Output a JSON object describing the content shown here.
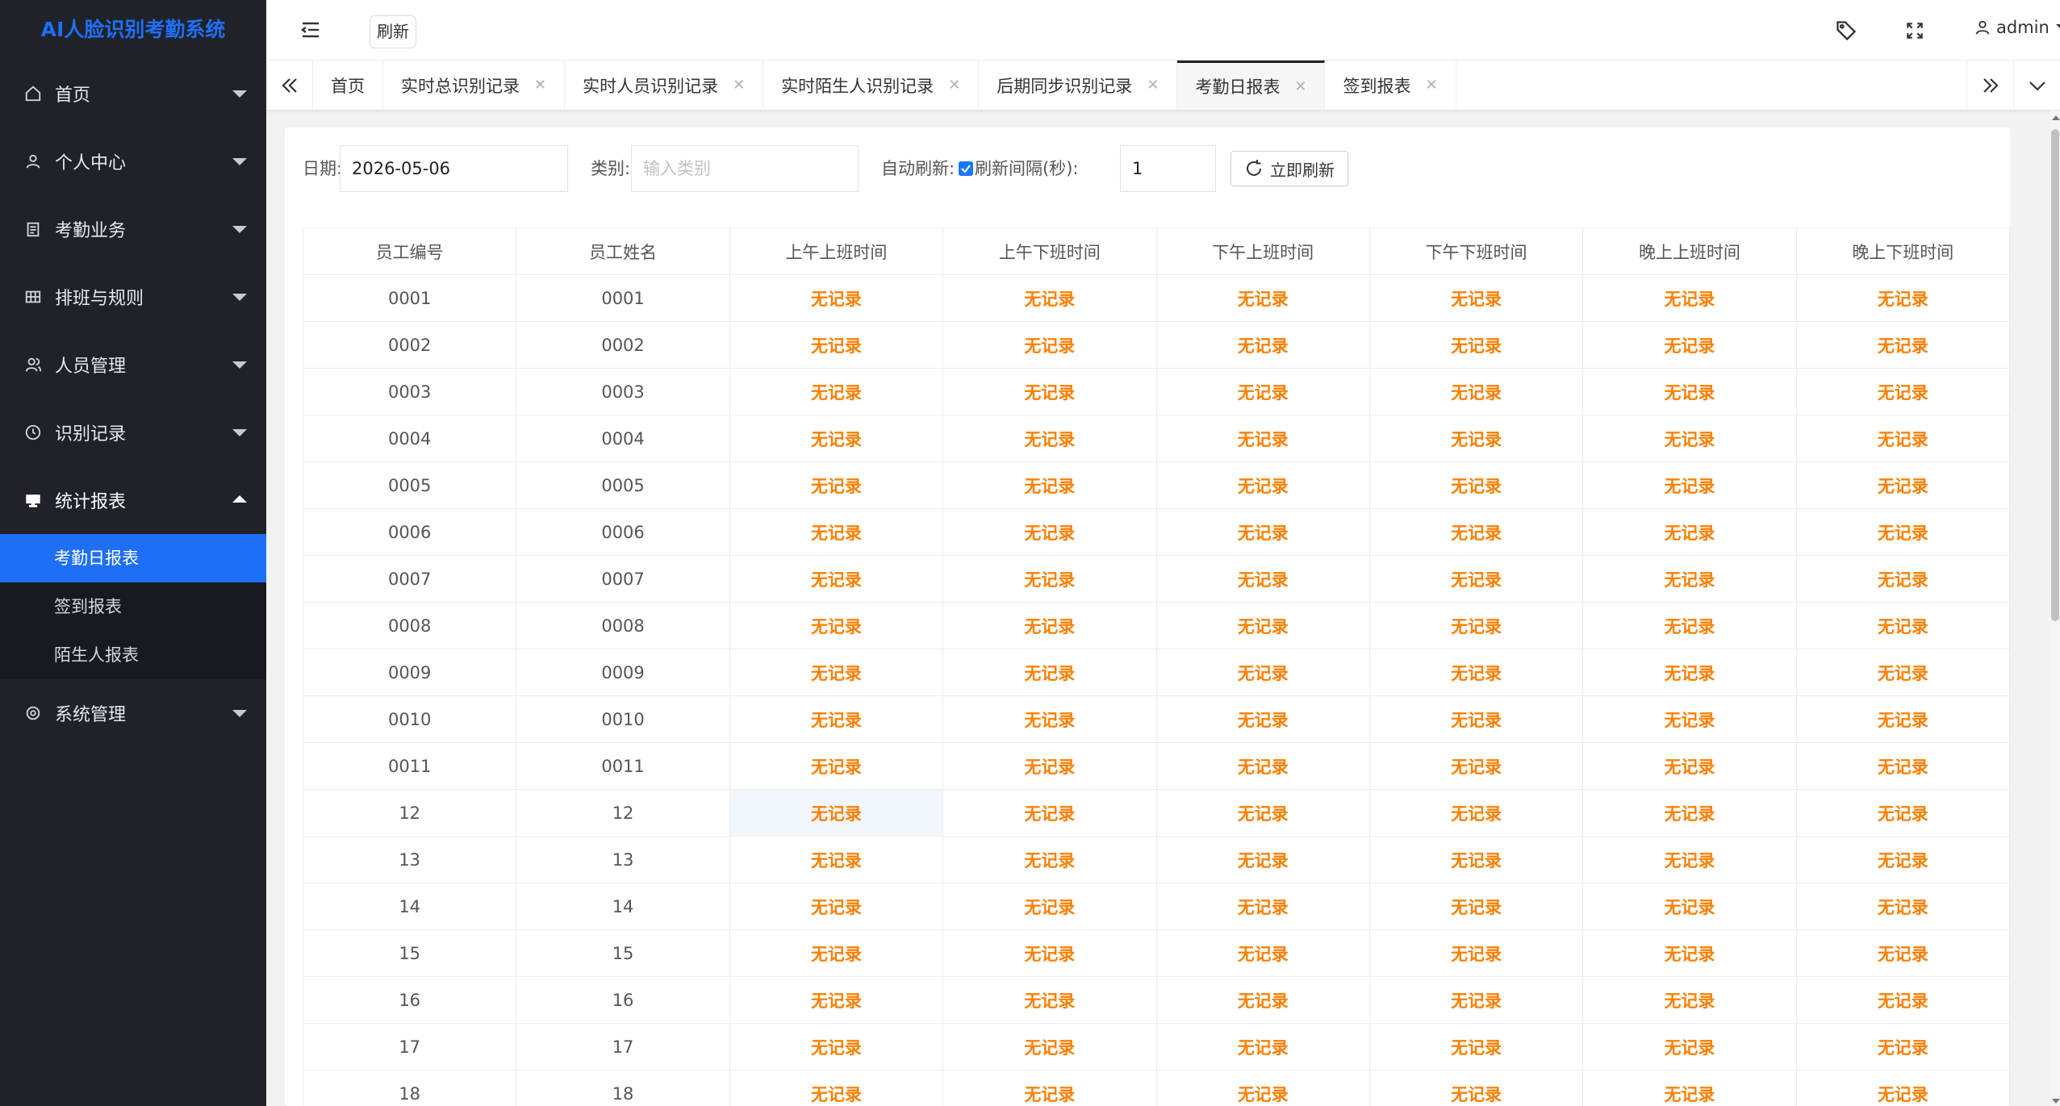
{
  "app": {
    "title": "AI人脸识别考勤系统"
  },
  "header": {
    "refresh_label": "刷新",
    "user_name": "admin"
  },
  "sidebar": {
    "items": [
      {
        "label": "首页",
        "icon": "home-icon"
      },
      {
        "label": "个人中心",
        "icon": "user-icon"
      },
      {
        "label": "考勤业务",
        "icon": "clipboard-icon"
      },
      {
        "label": "排班与规则",
        "icon": "grid-icon"
      },
      {
        "label": "人员管理",
        "icon": "people-icon"
      },
      {
        "label": "识别记录",
        "icon": "clock-icon"
      },
      {
        "label": "统计报表",
        "icon": "monitor-icon"
      },
      {
        "label": "系统管理",
        "icon": "settings-icon"
      }
    ],
    "submenu": [
      {
        "label": "考勤日报表"
      },
      {
        "label": "签到报表"
      },
      {
        "label": "陌生人报表"
      }
    ]
  },
  "tabs": [
    {
      "label": "首页"
    },
    {
      "label": "实时总识别记录"
    },
    {
      "label": "实时人员识别记录"
    },
    {
      "label": "实时陌生人识别记录"
    },
    {
      "label": "后期同步识别记录"
    },
    {
      "label": "考勤日报表"
    },
    {
      "label": "签到报表"
    }
  ],
  "filters": {
    "date_label": "日期:",
    "date_value": "2026-05-06",
    "category_label": "类别:",
    "category_placeholder": "输入类别",
    "auto_refresh_label": "自动刷新:",
    "interval_label": "刷新间隔(秒):",
    "interval_value": "1",
    "refresh_now_label": "立即刷新"
  },
  "table": {
    "columns": [
      "员工编号",
      "员工姓名",
      "上午上班时间",
      "上午下班时间",
      "下午上班时间",
      "下午下班时间",
      "晚上上班时间",
      "晚上下班时间"
    ],
    "no_record": "无记录",
    "rows": [
      {
        "id": "0001",
        "name": "0001"
      },
      {
        "id": "0002",
        "name": "0002"
      },
      {
        "id": "0003",
        "name": "0003"
      },
      {
        "id": "0004",
        "name": "0004"
      },
      {
        "id": "0005",
        "name": "0005"
      },
      {
        "id": "0006",
        "name": "0006"
      },
      {
        "id": "0007",
        "name": "0007"
      },
      {
        "id": "0008",
        "name": "0008"
      },
      {
        "id": "0009",
        "name": "0009"
      },
      {
        "id": "0010",
        "name": "0010"
      },
      {
        "id": "0011",
        "name": "0011"
      },
      {
        "id": "12",
        "name": "12"
      },
      {
        "id": "13",
        "name": "13"
      },
      {
        "id": "14",
        "name": "14"
      },
      {
        "id": "15",
        "name": "15"
      },
      {
        "id": "16",
        "name": "16"
      },
      {
        "id": "17",
        "name": "17"
      },
      {
        "id": "18",
        "name": "18"
      }
    ]
  },
  "colors": {
    "accent": "#1e6ff5",
    "no_record": "#ff7f00",
    "sidebar_bg": "#20222a"
  }
}
